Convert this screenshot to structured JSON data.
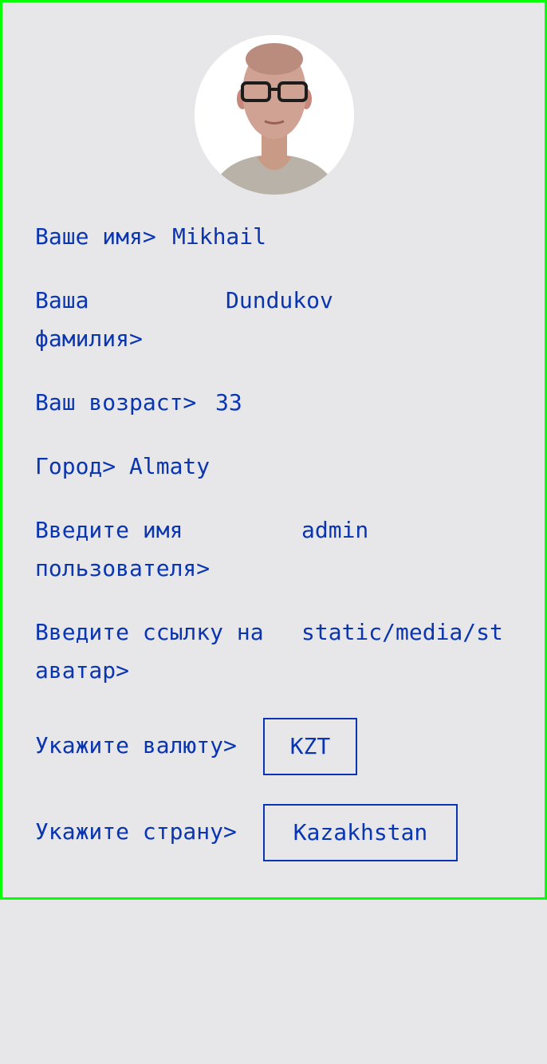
{
  "profile": {
    "avatar_icon": "user-photo",
    "fields": {
      "first_name": {
        "label": "Ваше имя>",
        "value": "Mikhail"
      },
      "last_name": {
        "label": "Ваша фамилия>",
        "value": "Dundukov"
      },
      "age": {
        "label": "Ваш возраст>",
        "value": "33"
      },
      "city": {
        "label": "Город>",
        "value": "Almaty"
      },
      "username": {
        "label": "Введите имя пользователя>",
        "value": "admin"
      },
      "avatar_url": {
        "label": "Введите ссылку на аватар>",
        "value": "static/media/st"
      },
      "currency": {
        "label": "Укажите валюту>",
        "value": "KZT"
      },
      "country": {
        "label": "Укажите страну>",
        "value": "Kazakhstan"
      }
    }
  },
  "colors": {
    "text": "#0a35b0",
    "frame_border": "#05ff05",
    "background": "#e7e7ea"
  }
}
